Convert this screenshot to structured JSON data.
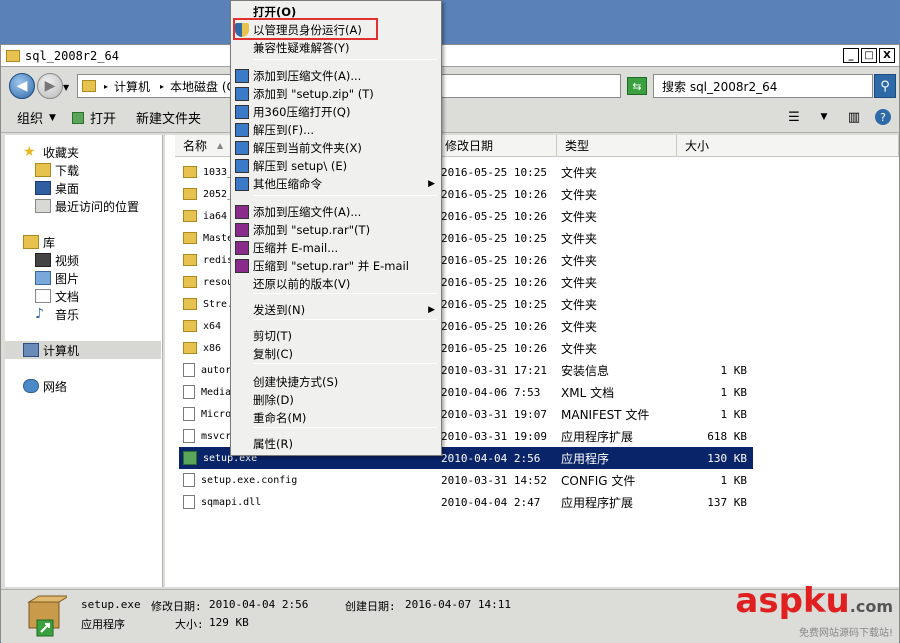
{
  "window": {
    "title": "sql_2008r2_64",
    "min": "_",
    "max": "□",
    "close": "X"
  },
  "address": {
    "crumbs": [
      "计算机",
      "本地磁盘 (C:)"
    ],
    "search_placeholder": "搜索 sql_2008r2_64"
  },
  "toolbar": {
    "organize": "组织",
    "open": "打开",
    "new_folder": "新建文件夹"
  },
  "sidebar": {
    "favorites": "收藏夹",
    "downloads": "下载",
    "desktop": "桌面",
    "recent": "最近访问的位置",
    "libraries": "库",
    "videos": "视频",
    "pictures": "图片",
    "documents": "文档",
    "music": "音乐",
    "computer": "计算机",
    "network": "网络"
  },
  "columns": {
    "name": "名称",
    "date": "修改日期",
    "type": "类型",
    "size": "大小"
  },
  "files": [
    {
      "name": "1033_...",
      "date": "2016-05-25 10:25",
      "type": "文件夹",
      "size": ""
    },
    {
      "name": "2052_...",
      "date": "2016-05-25 10:26",
      "type": "文件夹",
      "size": ""
    },
    {
      "name": "ia64",
      "date": "2016-05-25 10:26",
      "type": "文件夹",
      "size": ""
    },
    {
      "name": "Maste...",
      "date": "2016-05-25 10:25",
      "type": "文件夹",
      "size": ""
    },
    {
      "name": "redis...",
      "date": "2016-05-25 10:26",
      "type": "文件夹",
      "size": ""
    },
    {
      "name": "resou...",
      "date": "2016-05-25 10:26",
      "type": "文件夹",
      "size": ""
    },
    {
      "name": "Stre...",
      "date": "2016-05-25 10:25",
      "type": "文件夹",
      "size": ""
    },
    {
      "name": "x64",
      "date": "2016-05-25 10:26",
      "type": "文件夹",
      "size": ""
    },
    {
      "name": "x86",
      "date": "2016-05-25 10:26",
      "type": "文件夹",
      "size": ""
    },
    {
      "name": "autor...",
      "date": "2010-03-31 17:21",
      "type": "安装信息",
      "size": "1 KB"
    },
    {
      "name": "Media...",
      "date": "2010-04-06 7:53",
      "type": "XML 文档",
      "size": "1 KB"
    },
    {
      "name": "Micro...",
      "date": "2010-03-31 19:07",
      "type": "MANIFEST 文件",
      "size": "1 KB"
    },
    {
      "name": "msvcr...",
      "date": "2010-03-31 19:09",
      "type": "应用程序扩展",
      "size": "618 KB"
    },
    {
      "name": "setup.exe",
      "date": "2010-04-04 2:56",
      "type": "应用程序",
      "size": "130 KB"
    },
    {
      "name": "setup.exe.config",
      "date": "2010-03-31 14:52",
      "type": "CONFIG 文件",
      "size": "1 KB"
    },
    {
      "name": "sqmapi.dll",
      "date": "2010-04-04 2:47",
      "type": "应用程序扩展",
      "size": "137 KB"
    }
  ],
  "context_menu": [
    {
      "label": "打开(O)"
    },
    {
      "label": "以管理员身份运行(A)"
    },
    {
      "label": "兼容性疑难解答(Y)"
    },
    {
      "label": "添加到压缩文件(A)..."
    },
    {
      "label": "添加到 \"setup.zip\" (T)"
    },
    {
      "label": "用360压缩打开(Q)"
    },
    {
      "label": "解压到(F)..."
    },
    {
      "label": "解压到当前文件夹(X)"
    },
    {
      "label": "解压到 setup\\ (E)"
    },
    {
      "label": "其他压缩命令"
    },
    {
      "label": "添加到压缩文件(A)..."
    },
    {
      "label": "添加到 \"setup.rar\"(T)"
    },
    {
      "label": "压缩并 E-mail..."
    },
    {
      "label": "压缩到 \"setup.rar\" 并 E-mail"
    },
    {
      "label": "还原以前的版本(V)"
    },
    {
      "label": "发送到(N)"
    },
    {
      "label": "剪切(T)"
    },
    {
      "label": "复制(C)"
    },
    {
      "label": "创建快捷方式(S)"
    },
    {
      "label": "删除(D)"
    },
    {
      "label": "重命名(M)"
    },
    {
      "label": "属性(R)"
    }
  ],
  "status": {
    "filename": "setup.exe",
    "modified_label": "修改日期:",
    "modified": "2010-04-04 2:56",
    "created_label": "创建日期:",
    "created": "2016-04-07 14:11",
    "type": "应用程序",
    "size_label": "大小:",
    "size": "129 KB"
  },
  "watermark": {
    "brand": "aspku",
    "domain": ".com",
    "slogan": "免费网站源码下载站!"
  },
  "colors": {
    "selection": "#0a246a",
    "highlight_box": "#e03030"
  }
}
